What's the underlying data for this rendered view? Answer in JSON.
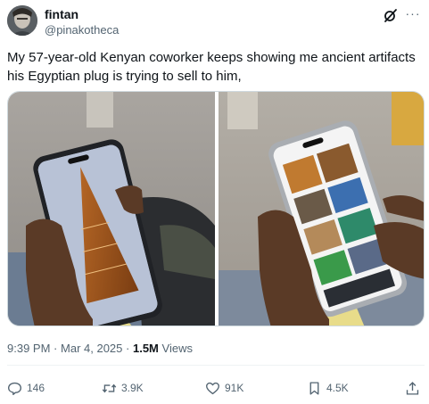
{
  "author": {
    "name": "fintan",
    "handle": "@pinakotheca"
  },
  "icons": {
    "grok": "grok-icon",
    "more": "more-icon",
    "reply": "reply-icon",
    "repost": "repost-icon",
    "like": "like-icon",
    "bookmark": "bookmark-icon",
    "share": "share-icon"
  },
  "more_glyph": "···",
  "tweet": {
    "text": "My 57-year-old Kenyan coworker keeps showing me ancient artifacts his Egyptian plug is trying to sell to him,"
  },
  "meta": {
    "time": "9:39 PM",
    "sep": "·",
    "date": "Mar 4, 2025",
    "views_count": "1.5M",
    "views_label": "Views"
  },
  "actions": {
    "replies": "146",
    "reposts": "3.9K",
    "likes": "91K",
    "bookmarks": "4.5K"
  },
  "colors": {
    "text": "#0f1419",
    "secondary": "#536471",
    "border": "#cfd9de"
  }
}
